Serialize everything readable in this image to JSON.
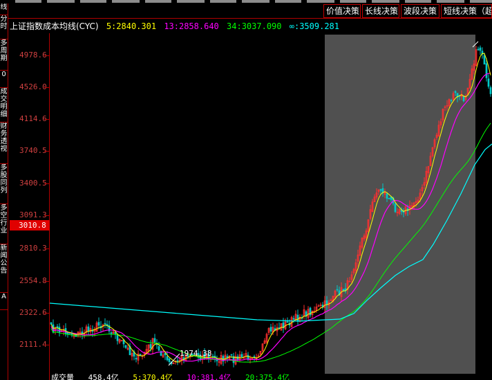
{
  "sidebar": {
    "tabs": [
      {
        "label": "线",
        "h": 17
      },
      {
        "label": "分时",
        "h": 35
      },
      {
        "label": "多周期",
        "h": 45
      },
      {
        "label": "0",
        "h": 25
      },
      {
        "label": "成交明细",
        "h": 50
      },
      {
        "label": "财务透视",
        "h": 60
      },
      {
        "label": "多股同列",
        "h": 58
      },
      {
        "label": "多空行业",
        "h": 58
      },
      {
        "label": "新闻公告",
        "h": 70
      },
      {
        "label": "A",
        "h": 25
      }
    ]
  },
  "header": {
    "buttons": [
      "价值决策",
      "长线决策",
      "波段决策",
      "短线决策（超"
    ]
  },
  "indicator": {
    "title": "上证指数成本均线(CYC)",
    "ma5": "5:2840.301",
    "ma13": "13:2858.640",
    "ma34": "34:3037.090",
    "inf": "∞:3509.281"
  },
  "axis": {
    "ticks": [
      "4978.6",
      "4526.0",
      "4114.6",
      "3740.5",
      "3400.5",
      "3091.3",
      "2810.3",
      "2554.8",
      "2322.6",
      "2111.4"
    ],
    "current": "3010.8"
  },
  "annotations": {
    "low": "1974.38"
  },
  "bottom": {
    "label": "成交量",
    "items": [
      "458.4亿",
      "5:370.4亿",
      "10:381.4亿",
      "20:375.4亿"
    ]
  },
  "colors": {
    "ma5": "#ffff00",
    "ma13": "#ff00ff",
    "ma34": "#00ff00",
    "inf": "#00ffff",
    "up": "#ff3030",
    "down": "#00c8c8",
    "highlight": "#505050"
  }
}
